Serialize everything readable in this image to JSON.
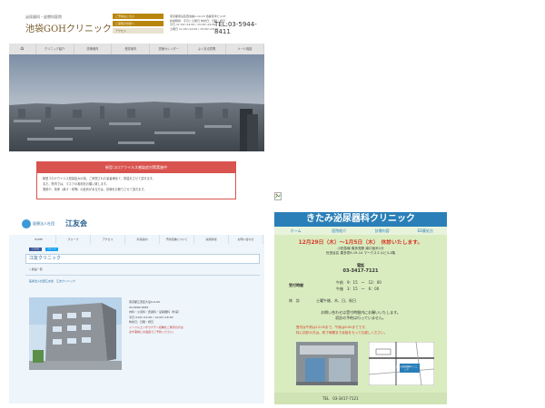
{
  "tile1": {
    "subtitle": "泌尿器科・皮膚科医院",
    "logo": "池袋GOHクリニック",
    "header_buttons": [
      "ご予約はこちら",
      "ご来院の皆様へ",
      "アクセス"
    ],
    "address_lines": [
      "東京都豊島区西池袋1-10-15 池袋東洋ビル3F",
      "診療時間　平日と土曜日 休診日：日曜・祝日",
      "平日 11:00～14:00 / 15:00～20:00",
      "土曜日 11:00～14:00 / 15:00～18:00"
    ],
    "tel": "TEL:03-5944-8411",
    "nav": [
      "クリニック紹介",
      "診療案内",
      "受診案内",
      "診療カレンダー",
      "よくある質問",
      "メール相談"
    ],
    "news_title": "新型コロナウイルス感染症対策実施中",
    "news_lines": [
      "新型コロナウイルス感染拡大の為、ご来院された患者様全て、検温をさせて頂きます。",
      "また、院内では、マスクの着用をお願い致します。",
      "発熱や、風邪（鼻汁・咳等）の症状がある方は、診療をお断りさせて頂きます。"
    ],
    "colors": {
      "accent": "#b8860b",
      "news": "#d9534f"
    }
  },
  "tile2": {
    "corp": "医療法人社団",
    "name": "江友会",
    "nav": [
      "HOME",
      "グループ",
      "アクセス",
      "外来案内",
      "予防接種について",
      "採用情報",
      "お問い合わせ"
    ],
    "share": [
      "いいね",
      "ツイート"
    ],
    "page_title": "江友クリニック",
    "crumb": "» 施設一覧",
    "section": "医療法人社団江友会　江友クリニック",
    "info_lines": [
      "東京都江東区大島9-9-99",
      "03-9999-9999",
      "内科・小児科・皮膚科・泌尿器科（外来）",
      "平日 9:00～12:00 / 14:00～18:00",
      "休診日：日曜・祝日"
    ],
    "warn_lines": [
      "インフルエンザワクチン接種をご希望の方は",
      "必ず事前にお電話でご予約ください。"
    ],
    "colors": {
      "brand": "#1f5c8c"
    }
  },
  "tile3": {
    "title": "きたみ泌尿器科クリニック",
    "nav": [
      "ホーム",
      "医院紹介",
      "診療内容",
      "ED薬処方"
    ],
    "holiday": "12月29日（木）～1月5日（木）　休診いたします。",
    "address": [
      "小田急線 喜多見駅 南口徒歩1分",
      "世田谷区 喜多見9-19-14 マークスエルビル1階"
    ],
    "tel_label": "電話",
    "tel": "03-3417-7121",
    "hours_label": "受付時間",
    "hours": [
      "午前　9：15　～　12：00",
      "午後　3：15　～　6：00"
    ],
    "off_label": "休　診",
    "off_days": "土曜午後、木、日、祝日",
    "ask": [
      "お問い合わせは受付時間内にお願いいたします。",
      "初診の予約は行っていません。"
    ],
    "notice": [
      "受付は午前は12:00まで、午後は6:00までです。",
      "特に初診の方は、終了時間まで余裕をもってお越しください。"
    ],
    "map_label": "きたみ泌尿器科クリニック",
    "footer_tel": "TEL　03-3417-7121",
    "colors": {
      "header": "#2a7fb8",
      "bg": "#d9ecbf",
      "alert": "#d63a2a"
    }
  }
}
